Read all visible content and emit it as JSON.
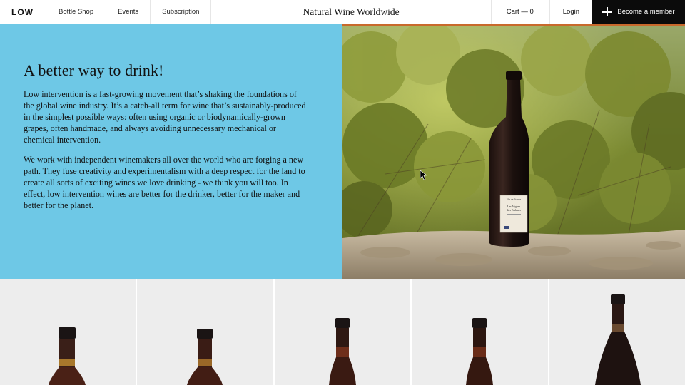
{
  "brand": {
    "logo": "LOW",
    "site_title": "Natural Wine Worldwide"
  },
  "nav": {
    "links": [
      "Bottle Shop",
      "Events",
      "Subscription"
    ],
    "cart": "Cart — 0",
    "login": "Login",
    "member": "Become a member"
  },
  "hero": {
    "title": "A better way to drink!",
    "paragraph_1": "Low intervention is a fast-growing movement that’s shaking the foundations of the global wine industry. It’s a catch-all term for wine that’s sustainably-produced in the simplest possible ways: often using organic or biodynamically-grown grapes, often handmade, and always avoiding unnecessary mechanical or chemical intervention.",
    "paragraph_2": "We work with independent winemakers all over the world who are forging a new path. They fuse creativity and experimentalism with a deep respect for the land to create all sorts of exciting wines we love drinking - we think you will too. In effect, low intervention wines are better for the drinker, better for the maker and better for the planet.",
    "bottle_label": {
      "line1": "Vin de France",
      "line2": "Les Vignes",
      "line3": "des Enfants"
    }
  },
  "colors": {
    "hero_bg": "#6ec8e6",
    "accent": "#c8692c",
    "member_bg": "#0b0b0b",
    "product_bg": "#ededed"
  },
  "products": [
    {
      "name": "product-1",
      "bottle": "burgundy"
    },
    {
      "name": "product-2",
      "bottle": "burgundy"
    },
    {
      "name": "product-3",
      "bottle": "tall"
    },
    {
      "name": "product-4",
      "bottle": "tall"
    },
    {
      "name": "product-5",
      "bottle": "wide"
    }
  ]
}
